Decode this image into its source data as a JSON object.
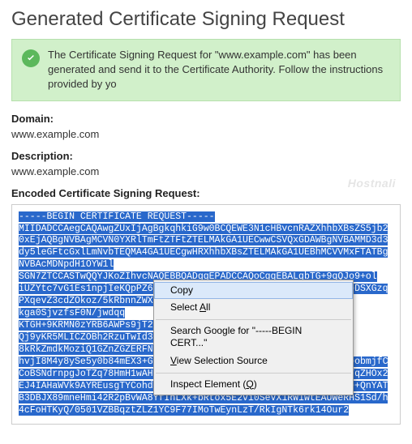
{
  "title": "Generated Certificate Signing Request",
  "alert": {
    "text": "The Certificate Signing Request for \"www.example.com\" has been generated and send it to the Certificate Authority. Follow the instructions provided by yo"
  },
  "fields": {
    "domain_label": "Domain:",
    "domain_value": "www.example.com",
    "description_label": "Description:",
    "description_value": "www.example.com",
    "encoded_label": "Encoded Certificate Signing Request:"
  },
  "csr_lines": [
    "-----BEGIN CERTIFICATE REQUEST-----",
    "MIIDADCCAegCAQAwgZUxIjAgBgkqhkiG9w0BCQEWE3N1cHBvcnRAZXhhbXBsZS5jb20xEjAQBgNVBAgMCVN0YXRlTmFtZTFtZTELMAkGA1UECwwCSVQxGDAWBgNVBAMMD3d3dy5leGFtcGxlLmNvbTEQMA4GA1UECgwHRXhhbXBsZTELMAkGA1UEBhMCVVMxFTATBgNVBAcMDNpdH1OYW1l",
    "SGN7ZTCCASTwQQYJKoZIhvcNAQEBBQADggEPADCCAQoCggEBALqbTG+9qQJo9+ol",
    "iUZYtc7vG1Es1npjIeKQpPZ6gMYjEbKHtoobmjfCCoBSNdrHvWrdRuy2hf1bDSXGzq",
    "PXqevZ3cdZOkoz/5kRbnnZWXuUAIQqRg3dBd",
    "kga0SjvzfsF0N/jwdqq",
    "KTGH+9KRMN0zYRB6AWPs9jT2/Dvsw0Obes",
    "Qj9yKR5MLICZOBh2RzuTwId31ZC07LowoqrE5H28JzmSt1g",
    "8kRkZmdkMoziQ1GZnZGZERFNHRJU",
    "hvjI8M4y8ySe5y0b84mEX3+Gkg06wWXCtI+sGl4SInjEkQpPZ6gMYjEbKHtoobmjfCCoBSNdrnpgJoTZq78HmH1wAH66j0MuxyyOW/SwJ7I2yJVrF4uwNYMsPI4IJTqZHOx2EJ4IAHaWVk9AYREusgTYCohd5xt44q119SOCgv2LyAML9pFhrRRNd4psf94e+QnYATB3DBJX89mneHmi42R2pBvWA8YfIhLXk+bRtox5E2vi0SeVX1RW1wtEAUWeRHS1Sd/h4cFoHTKyQ/0501VZBBqztZLZ1YC9F77IMoTwEynLzT/RkIgNTk6rk14Our2"
  ],
  "context_menu": {
    "copy": "Copy",
    "select_all_pre": "Select ",
    "select_all_u": "A",
    "select_all_post": "ll",
    "search": "Search Google for \"-----BEGIN CERT...\"",
    "view_source_pre": "",
    "view_source_u": "V",
    "view_source_post": "iew Selection Source",
    "inspect_pre": "Inspect Element (",
    "inspect_u": "Q",
    "inspect_post": ")"
  },
  "watermark": "Hostnali"
}
